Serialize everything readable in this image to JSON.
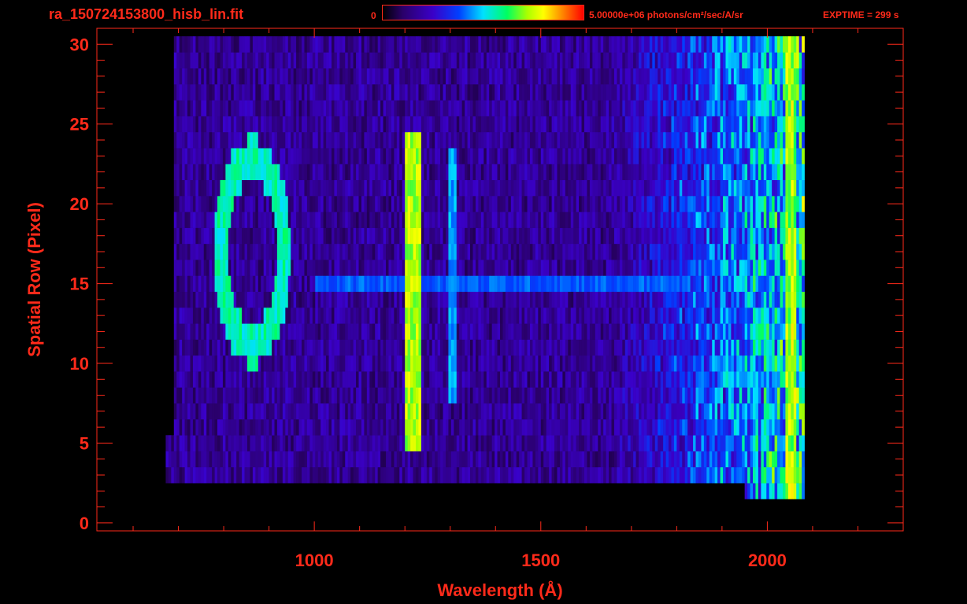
{
  "header": {
    "file_name": "ra_150724153800_hisb_lin.fit",
    "colorbar_min": "0",
    "colorbar_max": "5.00000e+06 photons/cm²/sec/A/sr",
    "exptime": "EXPTIME = 299 s"
  },
  "colors": {
    "axis": "#ff2a1a",
    "background": "#000000"
  },
  "chart_data": {
    "type": "heatmap",
    "title": "ra_150724153800_hisb_lin.fit",
    "xlabel": "Wavelength (Å)",
    "ylabel": "Spatial Row (Pixel)",
    "xlim": [
      520,
      2300
    ],
    "ylim": [
      -0.5,
      31
    ],
    "x_ticks": [
      1000,
      1500,
      2000
    ],
    "x_tick_labels": [
      "1000",
      "1500",
      "2000"
    ],
    "y_ticks": [
      0,
      5,
      10,
      15,
      20,
      25,
      30
    ],
    "y_tick_labels": [
      "0",
      "5",
      "10",
      "15",
      "20",
      "25",
      "30"
    ],
    "colorbar": {
      "min": 0,
      "max": 5000000,
      "units": "photons/cm²/sec/A/sr"
    },
    "grid": false,
    "features": [
      {
        "label": "ring",
        "center_wavelength": 860,
        "center_row": 17,
        "rows": [
          11,
          23
        ]
      },
      {
        "label": "bright line",
        "wavelength": 1216,
        "rows": [
          5,
          24
        ]
      },
      {
        "label": "weak line",
        "wavelength": 1304,
        "rows": [
          8,
          23
        ]
      },
      {
        "label": "continuum band",
        "row": 15,
        "wavelength_range": [
          1000,
          1830
        ]
      },
      {
        "label": "long-wavelength edge",
        "wavelength": 2060,
        "rows": [
          2,
          30
        ]
      }
    ]
  }
}
